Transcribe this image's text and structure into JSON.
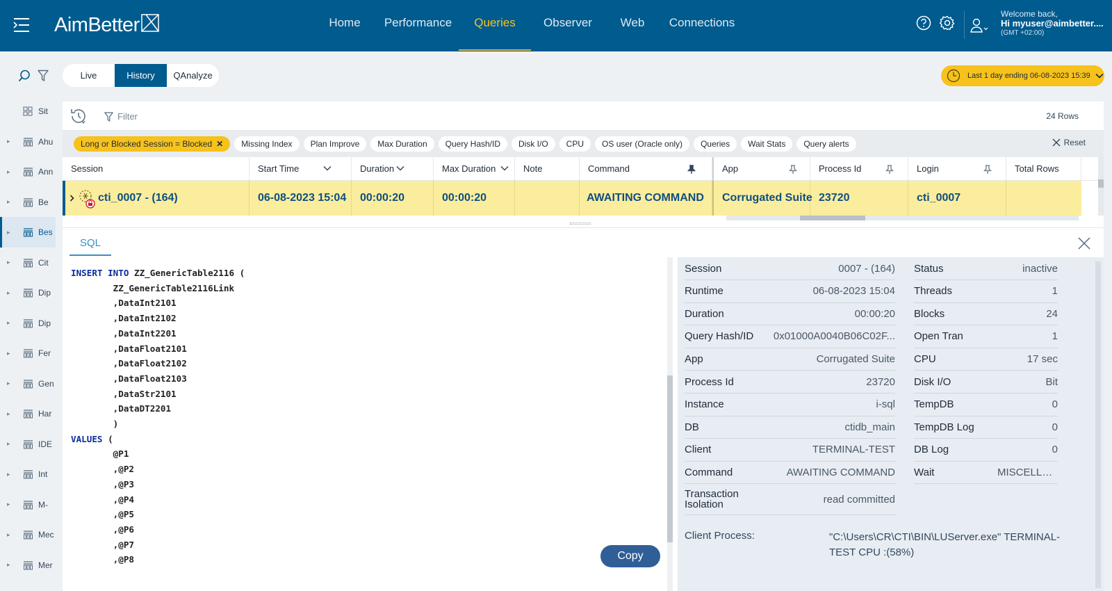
{
  "header": {
    "logo": "AimBetter",
    "nav": [
      {
        "label": "Home",
        "active": false
      },
      {
        "label": "Performance",
        "active": false
      },
      {
        "label": "Queries",
        "active": true
      },
      {
        "label": "Observer",
        "active": false
      },
      {
        "label": "Web",
        "active": false
      },
      {
        "label": "Connections",
        "active": false
      }
    ],
    "user": {
      "welcome": "Welcome back,",
      "name": "Hi myuser@aimbetter....",
      "tz": "(GMT +02:00)"
    }
  },
  "sidebar": {
    "items": [
      {
        "label": "Sit",
        "icon": "grid-icon",
        "active": false
      },
      {
        "label": "Ahu",
        "icon": "database-icon",
        "active": false
      },
      {
        "label": "Ann",
        "icon": "database-icon",
        "active": false
      },
      {
        "label": "Be",
        "icon": "database-icon",
        "active": false
      },
      {
        "label": "Bes",
        "icon": "database-icon",
        "active": true
      },
      {
        "label": "Cit",
        "icon": "database-icon",
        "active": false
      },
      {
        "label": "Dip",
        "icon": "database-icon",
        "active": false
      },
      {
        "label": "Dip",
        "icon": "database-icon",
        "active": false
      },
      {
        "label": "Fer",
        "icon": "database-icon",
        "active": false
      },
      {
        "label": "Gen",
        "icon": "database-icon",
        "active": false
      },
      {
        "label": "Har",
        "icon": "database-icon",
        "active": false
      },
      {
        "label": "IDE",
        "icon": "database-icon",
        "active": false
      },
      {
        "label": "Int",
        "icon": "database-icon",
        "active": false
      },
      {
        "label": "M-",
        "icon": "database-icon",
        "active": false
      },
      {
        "label": "Mec",
        "icon": "database-icon",
        "active": false
      },
      {
        "label": "Mer",
        "icon": "database-icon",
        "active": false
      }
    ]
  },
  "mode_tabs": [
    {
      "label": "Live",
      "active": false
    },
    {
      "label": "History",
      "active": true
    },
    {
      "label": "QAnalyze",
      "active": false
    }
  ],
  "time_range": "Last 1 day ending  06-08-2023 15:39",
  "filter": {
    "placeholder": "Filter",
    "rows": "24 Rows"
  },
  "chips": [
    {
      "label": "Long or Blocked Session = Blocked",
      "active": true
    },
    {
      "label": "Missing Index",
      "active": false
    },
    {
      "label": "Plan Improve",
      "active": false
    },
    {
      "label": "Max Duration",
      "active": false
    },
    {
      "label": "Query Hash/ID",
      "active": false
    },
    {
      "label": "Disk I/O",
      "active": false
    },
    {
      "label": "CPU",
      "active": false
    },
    {
      "label": "OS user (Oracle only)",
      "active": false
    },
    {
      "label": "Queries",
      "active": false
    },
    {
      "label": "Wait Stats",
      "active": false
    },
    {
      "label": "Query alerts",
      "active": false
    }
  ],
  "reset_label": "Reset",
  "table": {
    "columns": [
      "Session",
      "Start Time",
      "Duration",
      "Max Duration",
      "Note",
      "Command",
      "App",
      "Process Id",
      "Login",
      "Total Rows"
    ],
    "row": [
      "cti_0007 - (164)",
      "06-08-2023 15:04",
      "00:00:20",
      "00:00:20",
      "",
      "AWAITING COMMAND",
      "Corrugated Suite",
      "23720",
      "cti_0007",
      ""
    ]
  },
  "detail": {
    "tab": "SQL",
    "copy_label": "Copy",
    "sql": [
      [
        {
          "t": "INSERT INTO",
          "kw": true
        },
        {
          "t": " ZZ_GenericTable2116 (",
          "kw": false
        }
      ],
      [
        {
          "t": "        ZZ_GenericTable2116Link",
          "kw": false
        }
      ],
      [
        {
          "t": "        ,DataInt2101",
          "kw": false
        }
      ],
      [
        {
          "t": "        ,DataInt2102",
          "kw": false
        }
      ],
      [
        {
          "t": "        ,DataInt2201",
          "kw": false
        }
      ],
      [
        {
          "t": "        ,DataFloat2101",
          "kw": false
        }
      ],
      [
        {
          "t": "        ,DataFloat2102",
          "kw": false
        }
      ],
      [
        {
          "t": "        ,DataFloat2103",
          "kw": false
        }
      ],
      [
        {
          "t": "        ,DataStr2101",
          "kw": false
        }
      ],
      [
        {
          "t": "        ,DataDT2201",
          "kw": false
        }
      ],
      [
        {
          "t": "        )",
          "kw": false
        }
      ],
      [
        {
          "t": "VALUES",
          "kw": true
        },
        {
          "t": " (",
          "kw": false
        }
      ],
      [
        {
          "t": "        @P1",
          "kw": false
        }
      ],
      [
        {
          "t": "        ,@P2",
          "kw": false
        }
      ],
      [
        {
          "t": "        ,@P3",
          "kw": false
        }
      ],
      [
        {
          "t": "        ,@P4",
          "kw": false
        }
      ],
      [
        {
          "t": "        ,@P5",
          "kw": false
        }
      ],
      [
        {
          "t": "        ,@P6",
          "kw": false
        }
      ],
      [
        {
          "t": "        ,@P7",
          "kw": false
        }
      ],
      [
        {
          "t": "        ,@P8",
          "kw": false
        }
      ]
    ],
    "left": [
      {
        "k": "Session",
        "v": "0007 - (164)"
      },
      {
        "k": "Runtime",
        "v": "06-08-2023 15:04"
      },
      {
        "k": "Duration",
        "v": "00:00:20"
      },
      {
        "k": "Query Hash/ID",
        "v": "0x01000A0040B06C02F..."
      },
      {
        "k": "App",
        "v": "Corrugated Suite"
      },
      {
        "k": "Process Id",
        "v": "23720"
      },
      {
        "k": "Instance",
        "v": "i-sql"
      },
      {
        "k": "DB",
        "v": "ctidb_main"
      },
      {
        "k": "Client",
        "v": "TERMINAL-TEST"
      },
      {
        "k": "Command",
        "v": "AWAITING COMMAND"
      },
      {
        "k": "Transaction Isolation",
        "v": "read committed"
      }
    ],
    "right": [
      {
        "k": "Status",
        "v": "inactive"
      },
      {
        "k": "Threads",
        "v": "1"
      },
      {
        "k": "Blocks",
        "v": "24"
      },
      {
        "k": "Open Tran",
        "v": "1"
      },
      {
        "k": "CPU",
        "v": "17 sec"
      },
      {
        "k": "Disk I/O",
        "v": "Bit"
      },
      {
        "k": "TempDB",
        "v": "0"
      },
      {
        "k": "TempDB Log",
        "v": "0"
      },
      {
        "k": "DB Log",
        "v": "0"
      },
      {
        "k": "Wait",
        "v": "MISCELLANEOUS"
      }
    ],
    "client_process_label": "Client Process:",
    "client_process_value": "\"C:\\Users\\CR\\CTI\\BIN\\LUServer.exe\" TERMINAL-TEST CPU :(58%)"
  },
  "colors": {
    "brand": "#005b8f",
    "accent": "#f6c21b",
    "row_highlight": "#fbed9e"
  }
}
